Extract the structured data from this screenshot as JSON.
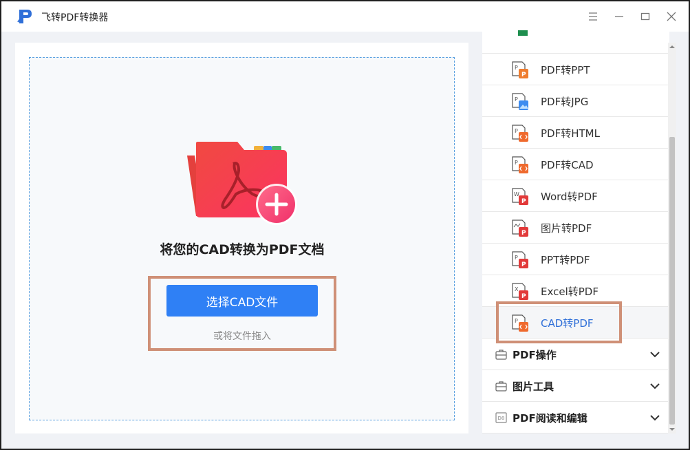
{
  "app": {
    "title": "飞转PDF转换器"
  },
  "colors": {
    "accent": "#2f80f5",
    "highlight_border": "#cf9077",
    "active_text": "#2f6fd8"
  },
  "main": {
    "heading": "将您的CAD转换为PDF文档",
    "select_button": "选择CAD文件",
    "drag_hint": "或将文件拖入"
  },
  "sidebar": {
    "items": [
      {
        "label": "PDF转PPT",
        "icon": "pdf-to-ppt-icon"
      },
      {
        "label": "PDF转JPG",
        "icon": "pdf-to-jpg-icon"
      },
      {
        "label": "PDF转HTML",
        "icon": "pdf-to-html-icon"
      },
      {
        "label": "PDF转CAD",
        "icon": "pdf-to-cad-icon"
      },
      {
        "label": "Word转PDF",
        "icon": "word-to-pdf-icon"
      },
      {
        "label": "图片转PDF",
        "icon": "image-to-pdf-icon"
      },
      {
        "label": "PPT转PDF",
        "icon": "ppt-to-pdf-icon"
      },
      {
        "label": "Excel转PDF",
        "icon": "excel-to-pdf-icon"
      },
      {
        "label": "CAD转PDF",
        "icon": "cad-to-pdf-icon",
        "active": true
      }
    ],
    "groups": [
      {
        "label": "PDF操作",
        "icon": "toolbox-icon"
      },
      {
        "label": "图片工具",
        "icon": "toolbox-icon"
      },
      {
        "label": "PDF阅读和编辑",
        "icon": "reader-icon"
      }
    ]
  }
}
